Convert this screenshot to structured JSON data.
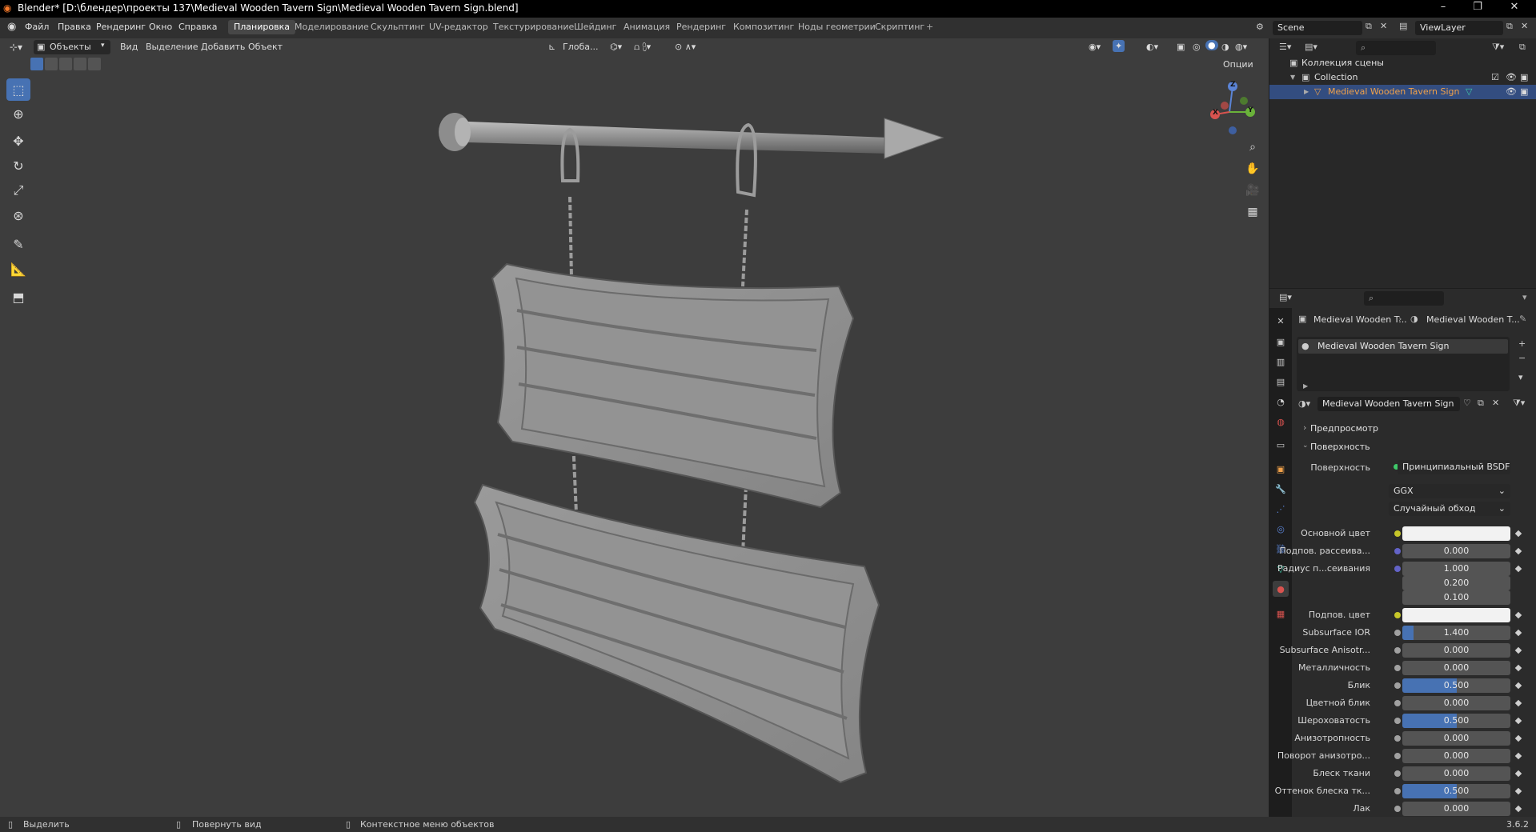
{
  "window": {
    "title": "Blender* [D:\\блендер\\проекты 137\\Medieval Wooden Tavern Sign\\Medieval Wooden Tavern Sign.blend]"
  },
  "menu": [
    "Файл",
    "Правка",
    "Рендеринг",
    "Окно",
    "Справка"
  ],
  "workspaces": [
    "Планировка",
    "Моделирование",
    "Скульптинг",
    "UV-редактор",
    "Текстурирование",
    "Шейдинг",
    "Анимация",
    "Рендеринг",
    "Композитинг",
    "Ноды геометрии",
    "Скриптинг"
  ],
  "add_workspace": "+",
  "scene": {
    "label": "Scene",
    "view_layer": "ViewLayer"
  },
  "viewport_header": {
    "mode": "Объекты",
    "menu": [
      "Вид",
      "Выделение",
      "Добавить",
      "Объект"
    ],
    "orientation": "Глоба...",
    "options": "Опции"
  },
  "gizmo": {
    "z": "Z",
    "y": "Y",
    "x": "X"
  },
  "outliner": {
    "scene_collection": "Коллекция сцены",
    "collection": "Collection",
    "object": "Medieval Wooden Tavern Sign"
  },
  "properties": {
    "breadcrumb_object": "Medieval Wooden T...",
    "breadcrumb_material": "Medieval Wooden T...",
    "slot": "Medieval Wooden Tavern Sign",
    "material_name": "Medieval Wooden Tavern Sign",
    "preview_section": "Предпросмотр",
    "surface_section": "Поверхность",
    "surface_label": "Поверхность",
    "surface_value": "Принципиальный BSDF",
    "distribution": "GGX",
    "subsurface_method": "Случайный обход",
    "rows": [
      {
        "label": "Основной цвет",
        "type": "color",
        "color": "#f2f2f2",
        "dot": "#c7c729"
      },
      {
        "label": "Подпов. рассеива...",
        "value": "0.000",
        "fill": 0,
        "dot": "#6363c7"
      },
      {
        "label": "Радиус п...сеивания",
        "value": "1.000",
        "fill": 0,
        "dot": "#6363c7"
      },
      {
        "label": "",
        "value": "0.200",
        "fill": 0,
        "dot": ""
      },
      {
        "label": "",
        "value": "0.100",
        "fill": 0,
        "dot": ""
      },
      {
        "label": "Подпов. цвет",
        "type": "color",
        "color": "#f2f2f2",
        "dot": "#c7c729"
      },
      {
        "label": "Subsurface IOR",
        "value": "1.400",
        "fill": 0.1,
        "dot": "#a1a1a1"
      },
      {
        "label": "Subsurface Anisotr...",
        "value": "0.000",
        "fill": 0,
        "dot": "#a1a1a1"
      },
      {
        "label": "Металличность",
        "value": "0.000",
        "fill": 0,
        "dot": "#a1a1a1"
      },
      {
        "label": "Блик",
        "value": "0.500",
        "fill": 0.5,
        "dot": "#a1a1a1"
      },
      {
        "label": "Цветной блик",
        "value": "0.000",
        "fill": 0,
        "dot": "#a1a1a1"
      },
      {
        "label": "Шероховатость",
        "value": "0.500",
        "fill": 0.5,
        "dot": "#a1a1a1"
      },
      {
        "label": "Анизотропность",
        "value": "0.000",
        "fill": 0,
        "dot": "#a1a1a1"
      },
      {
        "label": "Поворот анизотро...",
        "value": "0.000",
        "fill": 0,
        "dot": "#a1a1a1"
      },
      {
        "label": "Блеск ткани",
        "value": "0.000",
        "fill": 0,
        "dot": "#a1a1a1"
      },
      {
        "label": "Оттенок блеска тк...",
        "value": "0.500",
        "fill": 0.5,
        "dot": "#a1a1a1"
      },
      {
        "label": "Лак",
        "value": "0.000",
        "fill": 0,
        "dot": "#a1a1a1"
      }
    ]
  },
  "statusbar": {
    "select": "Выделить",
    "rotate": "Повернуть вид",
    "context": "Контекстное меню объектов",
    "version": "3.6.2"
  },
  "colors": {
    "accent": "#4772b3",
    "viewport_bg": "#3d3d3d",
    "selected_object": "#f0a14a"
  }
}
